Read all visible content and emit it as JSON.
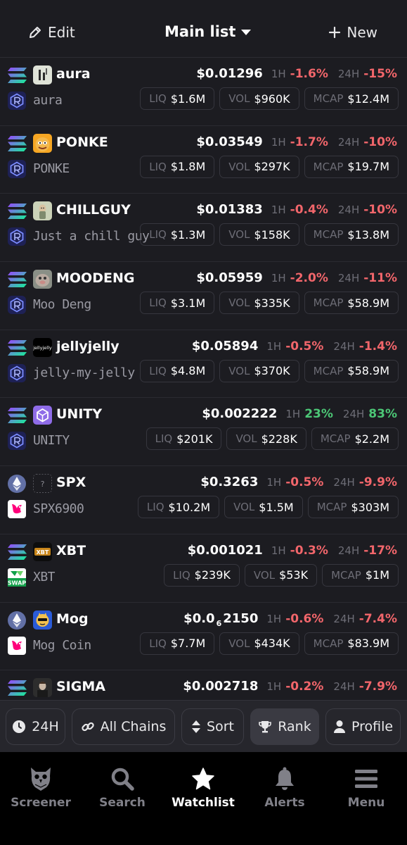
{
  "header": {
    "edit_label": "Edit",
    "title": "Main list",
    "new_label": "New"
  },
  "tokens": [
    {
      "chain": "solana",
      "dex": "raydium",
      "symbol": "aura",
      "name": "aura",
      "price": "$0.01296",
      "h1": "-1.6%",
      "h1_dir": "neg",
      "h24": "-15%",
      "h24_dir": "neg",
      "liq": "$1.6M",
      "vol": "$960K",
      "mcap": "$12.4M"
    },
    {
      "chain": "solana",
      "dex": "raydium",
      "symbol": "PONKE",
      "name": "PONKE",
      "price": "$0.03549",
      "h1": "-1.7%",
      "h1_dir": "neg",
      "h24": "-10%",
      "h24_dir": "neg",
      "liq": "$1.8M",
      "vol": "$297K",
      "mcap": "$19.7M"
    },
    {
      "chain": "solana",
      "dex": "raydium",
      "symbol": "CHILLGUY",
      "name": "Just a chill guy",
      "price": "$0.01383",
      "h1": "-0.4%",
      "h1_dir": "neg",
      "h24": "-10%",
      "h24_dir": "neg",
      "liq": "$1.3M",
      "vol": "$158K",
      "mcap": "$13.8M"
    },
    {
      "chain": "solana",
      "dex": "raydium",
      "symbol": "MOODENG",
      "name": "Moo Deng",
      "price": "$0.05959",
      "h1": "-2.0%",
      "h1_dir": "neg",
      "h24": "-11%",
      "h24_dir": "neg",
      "liq": "$3.1M",
      "vol": "$335K",
      "mcap": "$58.9M"
    },
    {
      "chain": "solana",
      "dex": "raydium",
      "symbol": "jellyjelly",
      "name": "jelly-my-jelly",
      "price": "$0.05894",
      "h1": "-0.5%",
      "h1_dir": "neg",
      "h24": "-1.4%",
      "h24_dir": "neg",
      "liq": "$4.8M",
      "vol": "$370K",
      "mcap": "$58.9M"
    },
    {
      "chain": "solana",
      "dex": "raydium",
      "symbol": "UNITY",
      "name": "UNITY",
      "price": "$0.002222",
      "h1": "23%",
      "h1_dir": "pos",
      "h24": "83%",
      "h24_dir": "pos",
      "liq": "$201K",
      "vol": "$228K",
      "mcap": "$2.2M"
    },
    {
      "chain": "ethereum",
      "dex": "uniswap",
      "symbol": "SPX",
      "name": "SPX6900",
      "price": "$0.3263",
      "h1": "-0.5%",
      "h1_dir": "neg",
      "h24": "-9.9%",
      "h24_dir": "neg",
      "liq": "$10.2M",
      "vol": "$1.5M",
      "mcap": "$303M"
    },
    {
      "chain": "solana",
      "dex": "swap",
      "symbol": "XBT",
      "name": "XBT",
      "price": "$0.001021",
      "h1": "-0.3%",
      "h1_dir": "neg",
      "h24": "-17%",
      "h24_dir": "neg",
      "liq": "$239K",
      "vol": "$53K",
      "mcap": "$1M"
    },
    {
      "chain": "ethereum",
      "dex": "uniswap",
      "symbol": "Mog",
      "name": "Mog Coin",
      "price_prefix": "$0.0",
      "price_sub": "6",
      "price_suffix": "2150",
      "h1": "-0.6%",
      "h1_dir": "neg",
      "h24": "-7.4%",
      "h24_dir": "neg",
      "liq": "$7.7M",
      "vol": "$434K",
      "mcap": "$83.9M"
    },
    {
      "chain": "solana",
      "dex": "raydium",
      "symbol": "SIGMA",
      "name": "",
      "price": "$0.002718",
      "h1": "-0.2%",
      "h1_dir": "neg",
      "h24": "-7.9%",
      "h24_dir": "neg",
      "liq": "",
      "vol": "",
      "mcap": ""
    }
  ],
  "labels": {
    "h1": "1H",
    "h24": "24H",
    "liq": "LIQ",
    "vol": "VOL",
    "mcap": "MCAP"
  },
  "filters": {
    "timeframe": "24H",
    "chains": "All Chains",
    "sort": "Sort",
    "rank": "Rank",
    "profile": "Profile"
  },
  "nav": {
    "screener": "Screener",
    "search": "Search",
    "watchlist": "Watchlist",
    "alerts": "Alerts",
    "menu": "Menu"
  },
  "colors": {
    "negative": "#f2666b",
    "positive": "#4cc776",
    "background": "#1c1c21"
  }
}
